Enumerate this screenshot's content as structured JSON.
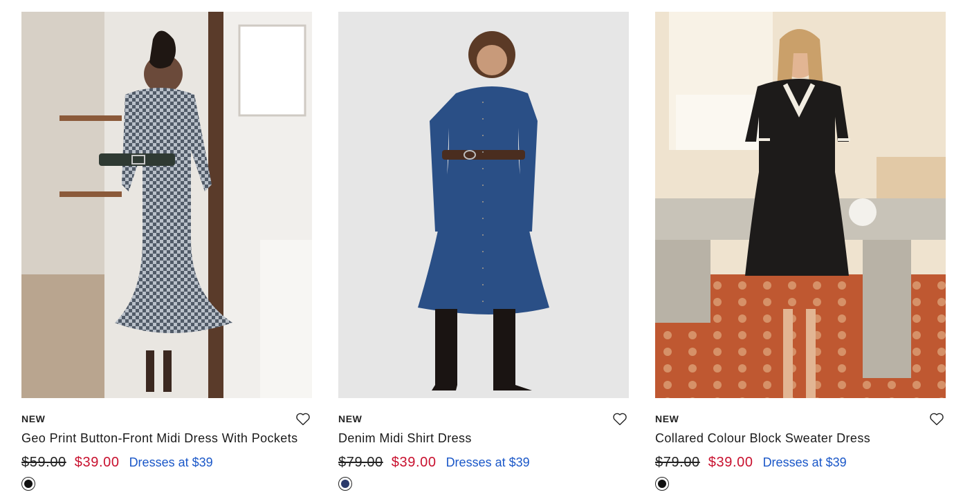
{
  "products": [
    {
      "badge": "NEW",
      "title": "Geo Print Button-Front Midi Dress With Pockets",
      "original_price": "$59.00",
      "sale_price": "$39.00",
      "promo": "Dresses at $39",
      "swatch_color": "#111111",
      "image": "photo of model in geo print shirt dress in a room with mirror and plants"
    },
    {
      "badge": "NEW",
      "title": "Denim Midi Shirt Dress",
      "original_price": "$79.00",
      "sale_price": "$39.00",
      "promo": "Dresses at $39",
      "swatch_color": "#2b3a6b",
      "image": "photo of model in dark denim midi shirt dress with belt and black boots"
    },
    {
      "badge": "NEW",
      "title": "Collared Colour Block Sweater Dress",
      "original_price": "$79.00",
      "sale_price": "$39.00",
      "promo": "Dresses at $39",
      "swatch_color": "#111111",
      "image": "photo of model in black sweater dress with white trim in sunlit office"
    }
  ],
  "icons": {
    "wishlist": "heart-outline-icon"
  },
  "colors": {
    "sale": "#c8102e",
    "promo_link": "#1a57c8"
  }
}
